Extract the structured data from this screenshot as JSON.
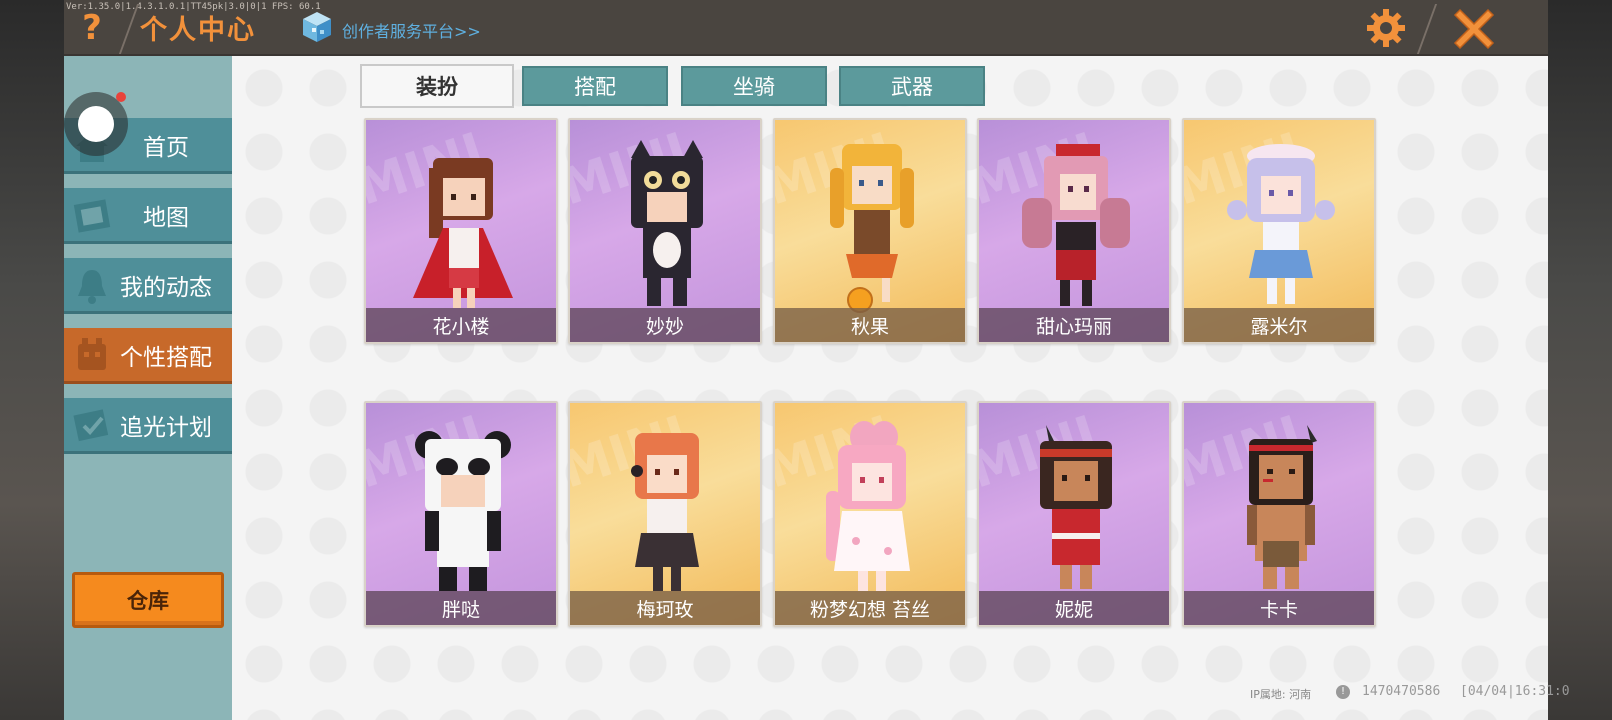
{
  "topbar": {
    "version_text": "Ver:1.35.0|1.4.3.1.0.1|TT45pk|3.0|0|1 FPS: 60.1",
    "help_glyph": "?",
    "title": "个人中心",
    "creator_link": "创作者服务平台>>"
  },
  "sidebar": {
    "items": [
      {
        "label": "首页",
        "icon": "home-icon",
        "active": false
      },
      {
        "label": "地图",
        "icon": "map-icon",
        "active": false
      },
      {
        "label": "我的动态",
        "icon": "bell-icon",
        "active": false
      },
      {
        "label": "个性搭配",
        "icon": "outfit-icon",
        "active": true
      },
      {
        "label": "追光计划",
        "icon": "plan-icon",
        "active": false
      }
    ],
    "warehouse_label": "仓库"
  },
  "tabs": [
    {
      "label": "装扮",
      "active": true
    },
    {
      "label": "搭配",
      "active": false
    },
    {
      "label": "坐骑",
      "active": false
    },
    {
      "label": "武器",
      "active": false
    }
  ],
  "skins": [
    {
      "name": "花小楼",
      "bg": "purple"
    },
    {
      "name": "妙妙",
      "bg": "purple"
    },
    {
      "name": "秋果",
      "bg": "gold"
    },
    {
      "name": "甜心玛丽",
      "bg": "purple"
    },
    {
      "name": "露米尔",
      "bg": "gold"
    },
    {
      "name": "胖哒",
      "bg": "purple"
    },
    {
      "name": "梅珂玫",
      "bg": "gold"
    },
    {
      "name": "粉梦幻想 苔丝",
      "bg": "gold"
    },
    {
      "name": "妮妮",
      "bg": "purple"
    },
    {
      "name": "卡卡",
      "bg": "purple"
    }
  ],
  "card_watermark": "MINI",
  "footer": {
    "ip_label": "IP属地: 河南",
    "uid": "1470470586",
    "time": "[04/04|16:31:0"
  },
  "colors": {
    "accent": "#f2913b",
    "nav_bg": "#4f8f99",
    "nav_active": "#c7692a",
    "card_purple": "#c394dc",
    "card_gold": "#f7c770"
  }
}
